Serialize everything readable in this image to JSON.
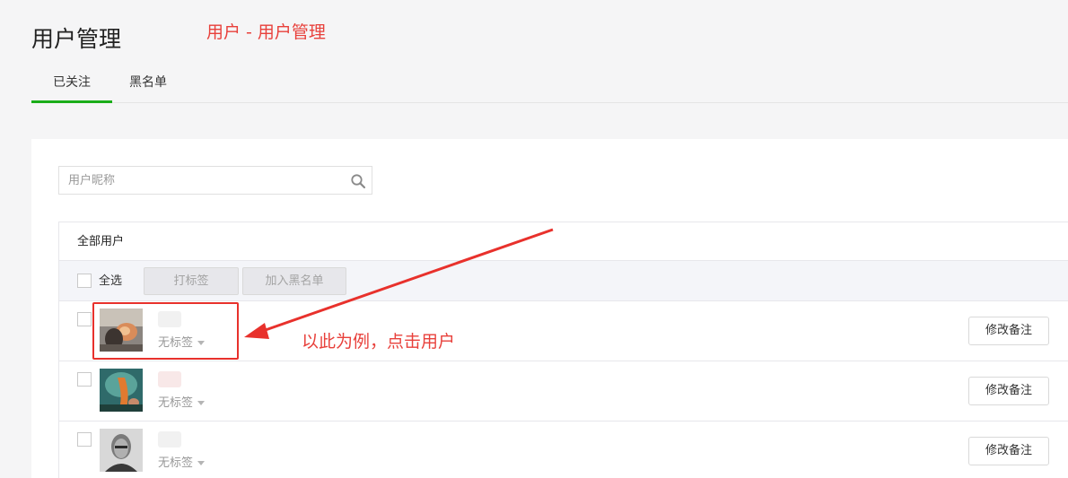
{
  "page": {
    "title": "用户管理",
    "annotation_breadcrumb": "用户 - 用户管理",
    "annotation_click": "以此为例，点击用户"
  },
  "tabs": [
    {
      "label": "已关注",
      "active": true
    },
    {
      "label": "黑名单",
      "active": false
    }
  ],
  "search": {
    "placeholder": "用户昵称",
    "value": "",
    "icon": "search-icon"
  },
  "list": {
    "header": "全部用户",
    "toolbar": {
      "select_all": "全选",
      "tag_button": "打标签",
      "blacklist_button": "加入黑名单"
    },
    "users": [
      {
        "tag": "无标签",
        "remark_button": "修改备注",
        "checked": false
      },
      {
        "tag": "无标签",
        "remark_button": "修改备注",
        "checked": false
      },
      {
        "tag": "无标签",
        "remark_button": "修改备注",
        "checked": false
      }
    ]
  },
  "colors": {
    "accent": "#1aad19",
    "annotation": "#e8403b",
    "background": "#f5f5f6"
  }
}
